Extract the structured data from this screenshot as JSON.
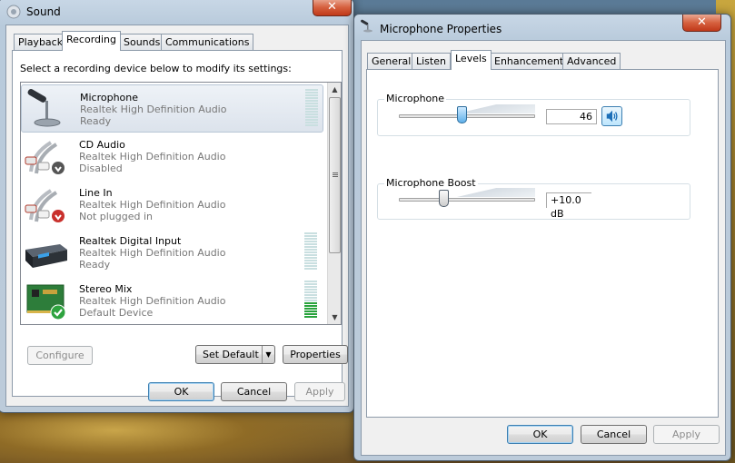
{
  "sound_window": {
    "title": "Sound",
    "tabs": [
      "Playback",
      "Recording",
      "Sounds",
      "Communications"
    ],
    "active_tab": "Recording",
    "instruction": "Select a recording device below to modify its settings:",
    "devices": [
      {
        "name": "Microphone",
        "driver": "Realtek High Definition Audio",
        "status": "Ready",
        "icon": "microphone-icon",
        "selected": true,
        "level": 0
      },
      {
        "name": "CD Audio",
        "driver": "Realtek High Definition Audio",
        "status": "Disabled",
        "icon": "cd-audio-cable-icon",
        "badge": "disabled-badge-icon",
        "level": null
      },
      {
        "name": "Line In",
        "driver": "Realtek High Definition Audio",
        "status": "Not plugged in",
        "icon": "line-in-cable-icon",
        "badge": "unplugged-badge-icon",
        "level": null
      },
      {
        "name": "Realtek Digital Input",
        "driver": "Realtek High Definition Audio",
        "status": "Ready",
        "icon": "digital-input-device-icon",
        "level": 0
      },
      {
        "name": "Stereo Mix",
        "driver": "Realtek High Definition Audio",
        "status": "Default Device",
        "icon": "sound-card-icon",
        "badge": "default-check-icon",
        "level": 0.4
      }
    ],
    "buttons": {
      "configure": "Configure",
      "set_default": "Set Default",
      "properties": "Properties",
      "ok": "OK",
      "cancel": "Cancel",
      "apply": "Apply"
    }
  },
  "mic_window": {
    "title": "Microphone Properties",
    "tabs": [
      "General",
      "Listen",
      "Levels",
      "Enhancements",
      "Advanced"
    ],
    "active_tab": "Levels",
    "microphone": {
      "label": "Microphone",
      "value": "46",
      "level": 0.46
    },
    "boost": {
      "label": "Microphone Boost",
      "value": "+10.0 dB",
      "level": 0.33
    },
    "buttons": {
      "ok": "OK",
      "cancel": "Cancel",
      "apply": "Apply"
    }
  },
  "colors": {
    "meter_active": "#29a33d",
    "meter_idle": "#c9dfe0",
    "accent": "#3c7fb1",
    "close_button": "#c0391a"
  }
}
